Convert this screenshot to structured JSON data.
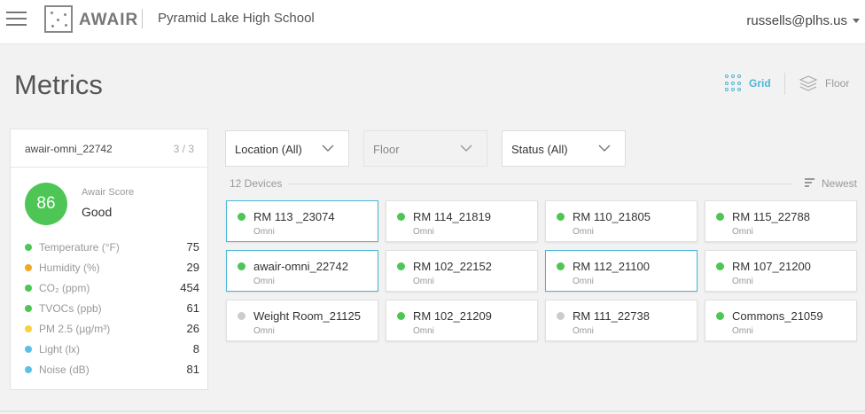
{
  "header": {
    "brand": "AWAIR",
    "organization": "Pyramid Lake High School",
    "user_email": "russells@plhs.us"
  },
  "page": {
    "title": "Metrics",
    "view_grid_label": "Grid",
    "view_floor_label": "Floor"
  },
  "side_panel": {
    "device_name": "awair-omni_22742",
    "pager": "3 / 3",
    "score": "86",
    "score_label": "Awair Score",
    "score_text": "Good",
    "score_color": "#4dc656",
    "metrics": [
      {
        "label": "Temperature (°F)",
        "value": "75",
        "color": "#4dc656"
      },
      {
        "label": "Humidity (%)",
        "value": "29",
        "color": "#f5a623"
      },
      {
        "label": "CO₂ (ppm)",
        "value": "454",
        "color": "#4dc656"
      },
      {
        "label": "TVOCs (ppb)",
        "value": "61",
        "color": "#4dc656"
      },
      {
        "label": "PM 2.5 (µg/m³)",
        "value": "26",
        "color": "#f8d23a"
      },
      {
        "label": "Light (lx)",
        "value": "8",
        "color": "#5bc0e8"
      },
      {
        "label": "Noise (dB)",
        "value": "81",
        "color": "#5bc0e8"
      }
    ]
  },
  "filters": {
    "location": "Location (All)",
    "floor": "Floor",
    "status": "Status (All)"
  },
  "device_list": {
    "count_label": "12 Devices",
    "sort_label": "Newest",
    "devices": [
      {
        "name": "RM 113 _23074",
        "type": "Omni",
        "status_color": "#4dc656",
        "selected": true
      },
      {
        "name": "RM 114_21819",
        "type": "Omni",
        "status_color": "#4dc656",
        "selected": false
      },
      {
        "name": "RM 110_21805",
        "type": "Omni",
        "status_color": "#4dc656",
        "selected": false
      },
      {
        "name": "RM 115_22788",
        "type": "Omni",
        "status_color": "#4dc656",
        "selected": false
      },
      {
        "name": "awair-omni_22742",
        "type": "Omni",
        "status_color": "#4dc656",
        "selected": true
      },
      {
        "name": "RM 102_22152",
        "type": "Omni",
        "status_color": "#4dc656",
        "selected": false
      },
      {
        "name": "RM 112_21100",
        "type": "Omni",
        "status_color": "#4dc656",
        "selected": true
      },
      {
        "name": "RM 107_21200",
        "type": "Omni",
        "status_color": "#4dc656",
        "selected": false
      },
      {
        "name": "Weight Room_21125",
        "type": "Omni",
        "status_color": "#cccccc",
        "selected": false
      },
      {
        "name": "RM 102_21209",
        "type": "Omni",
        "status_color": "#4dc656",
        "selected": false
      },
      {
        "name": "RM 111_22738",
        "type": "Omni",
        "status_color": "#cccccc",
        "selected": false
      },
      {
        "name": "Commons_21059",
        "type": "Omni",
        "status_color": "#4dc656",
        "selected": false
      }
    ]
  },
  "icons": {
    "menu": "hamburger-icon",
    "logo": "awair-logo-icon",
    "grid": "grid-dots-icon",
    "floor": "layers-icon",
    "dropdown": "chevron-down-icon",
    "sort": "sort-lines-icon"
  }
}
